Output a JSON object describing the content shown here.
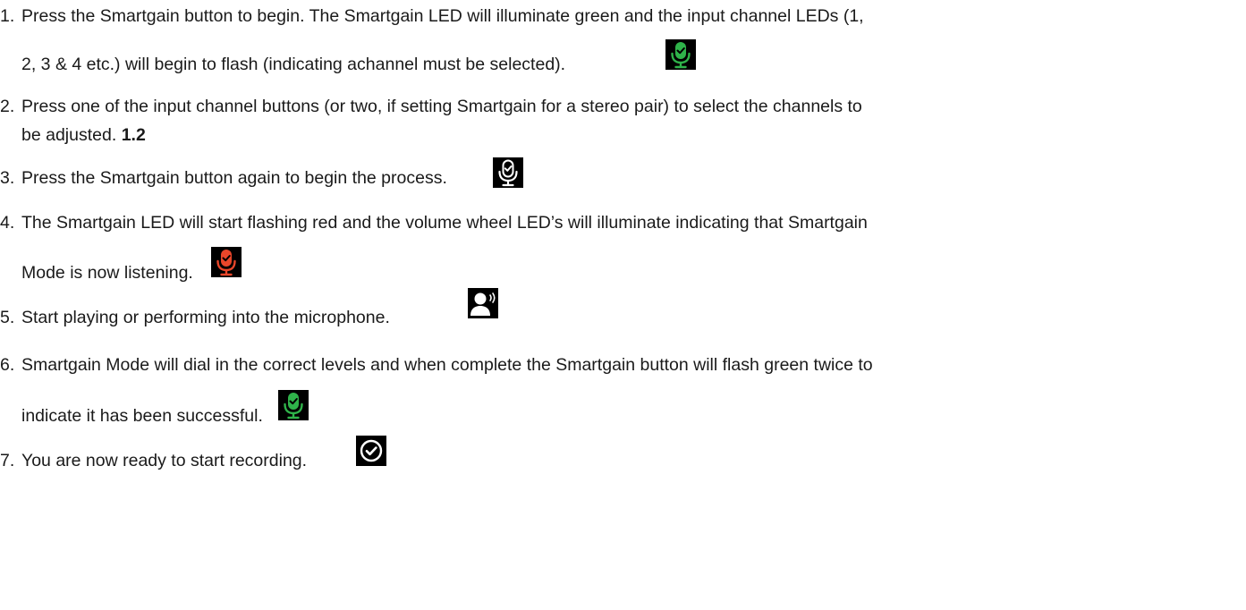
{
  "steps": [
    {
      "number": "1.",
      "line1": "Press the Smartgain button to begin. The Smartgain LED will illuminate green and the input channel LEDs (1,",
      "line2": "2, 3 & 4 etc.) will begin to flash (indicating achannel must be selected).",
      "icon": "mic-check-green-icon"
    },
    {
      "number": "2.",
      "line1": "Press one of the input channel buttons (or two, if setting Smartgain for a stereo pair) to select the channels to",
      "line2": "be adjusted.",
      "bold_suffix": "1.2"
    },
    {
      "number": "3.",
      "line1": "Press the Smartgain button again to begin the process.",
      "icon": "mic-check-white-icon"
    },
    {
      "number": "4.",
      "line1": "The Smartgain LED will start flashing red and the volume wheel LED’s will illuminate indicating that Smartgain",
      "line2": "Mode is now listening.",
      "icon": "mic-check-red-icon"
    },
    {
      "number": "5.",
      "line1": "Start playing or performing into the microphone.",
      "icon": "user-speaking-icon"
    },
    {
      "number": "6.",
      "line1": "Smartgain Mode will dial in the correct levels and when complete the Smartgain button will flash green twice to",
      "line2": "indicate it has been successful.",
      "icon": "mic-check-green-icon"
    },
    {
      "number": "7.",
      "line1": "You are now ready to start recording.",
      "icon": "check-circle-icon"
    }
  ],
  "colors": {
    "text": "#1a1a1a",
    "icon_bg": "#000000",
    "green": "#2fb34a",
    "red": "#e8462a",
    "white": "#ffffff"
  }
}
